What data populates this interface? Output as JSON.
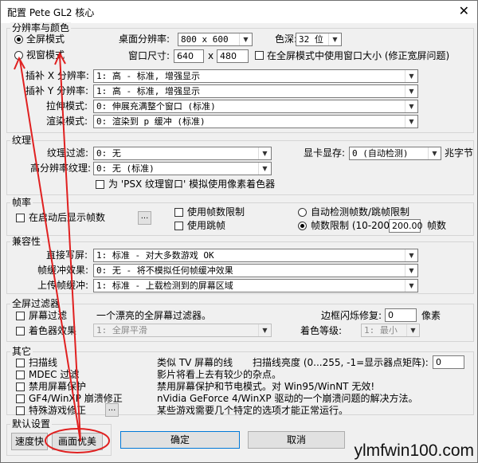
{
  "window": {
    "title": "配置 Pete GL2 核心",
    "close": "✕"
  },
  "resolution": {
    "group_title": "分辨率与颜色",
    "fullscreen_label": "全屏模式",
    "windowed_label": "视窗模式",
    "desktop_res_label": "桌面分辨率:",
    "desktop_res_value": "800  x  600",
    "color_label": "色深:",
    "color_value": "32 位",
    "window_size_label": "窗口尺寸:",
    "window_w": "640",
    "x_sep": "x",
    "window_h": "480",
    "use_window_size_label": "在全屏模式中使用窗口大小 (修正宽屏问题)",
    "x_scale_label": "插补 X 分辨率:",
    "x_scale_value": "1: 高 - 标准, 增强显示",
    "y_scale_label": "插补 Y 分辨率:",
    "y_scale_value": "1: 高 - 标准, 增强显示",
    "stretch_label": "拉伸模式:",
    "stretch_value": "0: 伸展充满整个窗口 (标准)",
    "render_label": "渲染模式:",
    "render_value": "0: 渲染到 p 缓冲 (标准)"
  },
  "texture": {
    "group_title": "纹理",
    "filter_label": "纹理过滤:",
    "filter_value": "0: 无",
    "vram_label": "显卡显存:",
    "vram_value": "0 (自动检测)",
    "vram_unit": "兆字节",
    "hires_label": "高分辨率纹理:",
    "hires_value": "0: 无 (标准)",
    "psx_label": "为 'PSX 纹理窗口' 模拟使用像素着色器"
  },
  "framerate": {
    "group_title": "帧率",
    "show_fps_label": "在启动后显示帧数",
    "dots": "...",
    "use_limit_label": "使用帧数限制",
    "use_skip_label": "使用跳帧",
    "auto_label": "自动检测帧数/跳帧限制",
    "limit_label": "帧数限制 (10-200)",
    "limit_value": "200.00",
    "limit_unit": "帧数"
  },
  "compat": {
    "group_title": "兼容性",
    "offscreen_label": "直接写屏:",
    "offscreen_value": "1: 标准 - 对大多数游戏 OK",
    "fbeffects_label": "帧缓冲效果:",
    "fbeffects_value": "0: 无 - 将不模拟任何帧缓冲效果",
    "upload_label": "上传帧缓冲:",
    "upload_value": "1: 标准 - 上载检测到的屏幕区域"
  },
  "filters": {
    "group_title": "全屏过滤器",
    "screen_filter_label": "屏幕过滤",
    "screen_filter_desc": "一个漂亮的全屏幕过滤器。",
    "edge_label": "边框闪烁修复:",
    "edge_value": "0",
    "edge_unit": "像素",
    "shader_label": "着色器效果",
    "shader_value": "1: 全屏平滑",
    "shader_level_label": "着色等级:",
    "shader_level_value": "1: 最小"
  },
  "misc": {
    "group_title": "其它",
    "scanlines_label": "扫描线",
    "scanlines_desc": "类似 TV 屏幕的线",
    "scan_bright_label": "扫描线亮度 (0...255, -1=显示器点矩阵):",
    "scan_bright_value": "0",
    "mdec_label": "MDEC 过滤",
    "mdec_desc": "影片将看上去有较少的杂点。",
    "screensaver_label": "禁用屏幕保护",
    "screensaver_desc": "禁用屏幕保护和节电模式。对 Win95/WinNT 无效!",
    "gf4_label": "GF4/WinXP 崩溃修正",
    "gf4_desc": "nVidia GeForce 4/WinXP 驱动的一个崩溃问题的解决方法。",
    "special_label": "特殊游戏修正",
    "special_dots": "...",
    "special_desc": "某些游戏需要几个特定的选项才能正常运行。"
  },
  "defaults": {
    "group_title": "默认设置",
    "fast_label": "速度快",
    "nice_label": "画面优美"
  },
  "buttons": {
    "ok": "确定",
    "cancel": "取消"
  },
  "watermark": "ylmfwin100.com",
  "colors": {
    "annotation_red": "#e02020",
    "focus_blue": "#0078d7"
  }
}
